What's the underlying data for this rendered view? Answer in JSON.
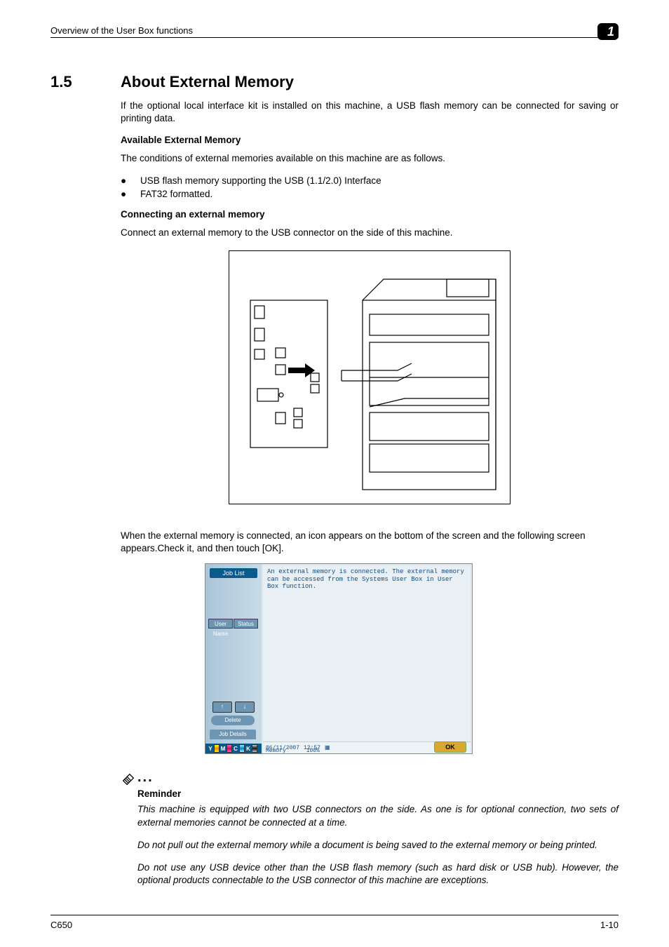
{
  "header": {
    "running_title": "Overview of the User Box functions",
    "chapter_badge": "1"
  },
  "section": {
    "number": "1.5",
    "title": "About External Memory"
  },
  "intro": "If the optional local interface kit is installed on this machine, a USB flash memory can be connected for saving or printing data.",
  "sub1": {
    "title": "Available External Memory",
    "lead": "The conditions of external memories available on this machine are as follows."
  },
  "bullets": [
    "USB flash memory supporting the USB (1.1/2.0) Interface",
    "FAT32 formatted."
  ],
  "sub2": {
    "title": "Connecting an external memory",
    "lead": "Connect an external memory to the USB connector on the side of this machine."
  },
  "after_figure": "When the external memory is connected, an icon appears on the bottom of the screen and the following screen appears.Check it, and then touch [OK].",
  "panel": {
    "job_list": "Job List",
    "user_name": "User Name",
    "status": "Status",
    "delete": "Delete",
    "job_details": "Job Details",
    "toner": {
      "y": "Y",
      "m": "M",
      "c": "C",
      "k": "K"
    },
    "message": "An external memory is connected. The external memory can be accessed from the Systems User Box in User Box function.",
    "date": "06/11/2007",
    "time": "12:57",
    "memory_label": "Memory",
    "memory_value": "100%",
    "ok": "OK"
  },
  "reminder": {
    "label": "Reminder",
    "p1": "This machine is equipped with two USB connectors on the side. As one is for optional connection, two sets of external memories cannot be connected at a time.",
    "p2": "Do not pull out the external memory while a document is being saved to the external memory or being printed.",
    "p3": "Do not use any USB device other than the USB flash memory (such as hard disk or USB hub). However, the optional products connectable to the USB connector of this machine are exceptions."
  },
  "footer": {
    "model": "C650",
    "page": "1-10"
  }
}
